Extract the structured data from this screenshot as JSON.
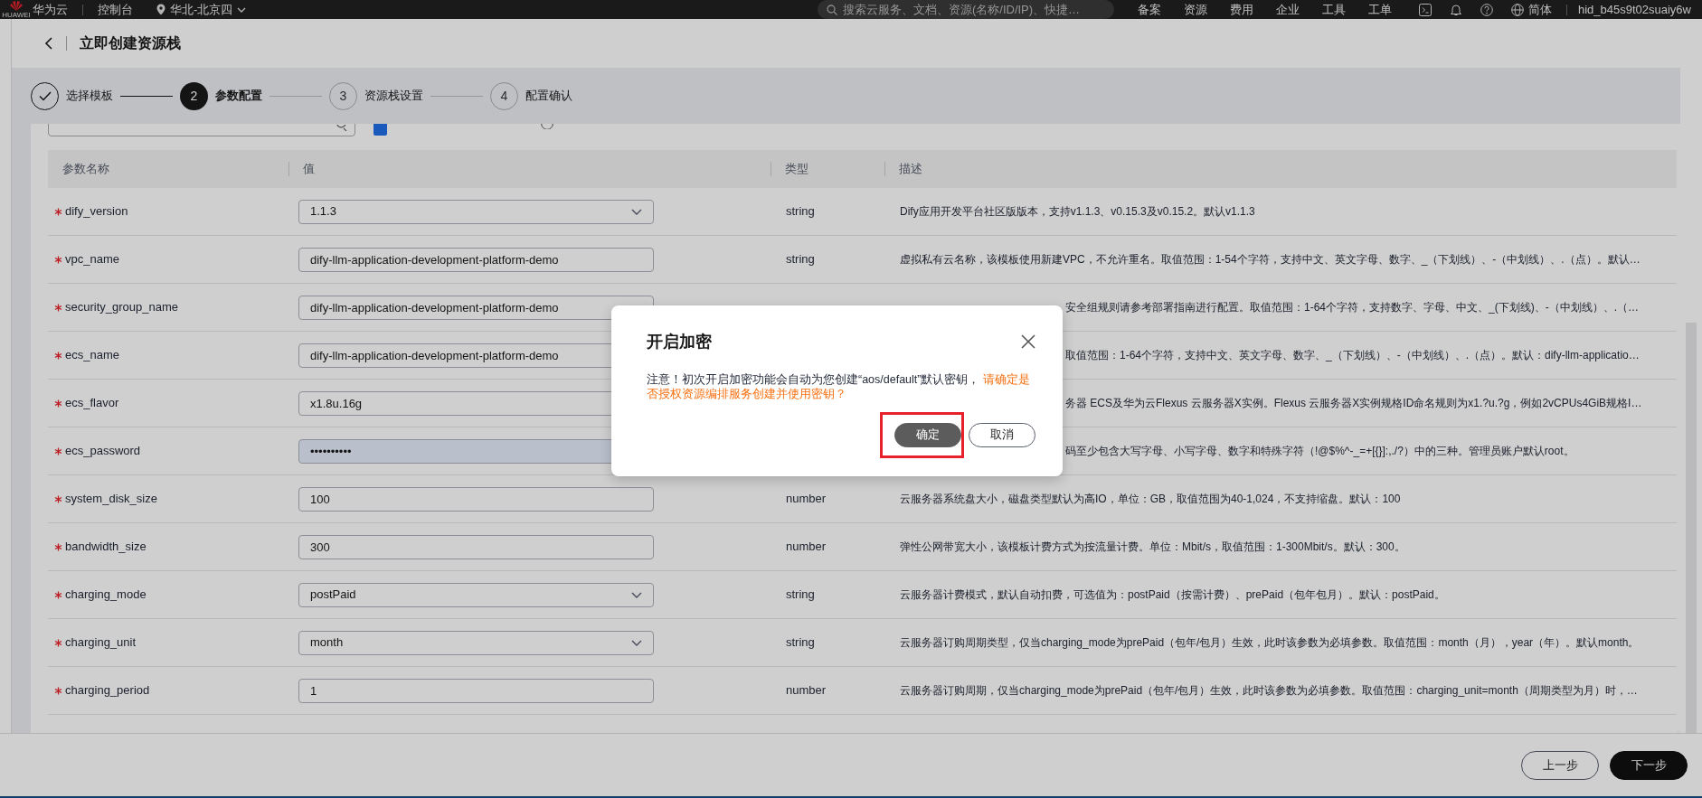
{
  "topbar": {
    "logo_text": "HUAWEI",
    "brand": "华为云",
    "console": "控制台",
    "region": "华北-北京四",
    "search": {
      "placeholder": "搜索云服务、文档、资源(名称/ID/IP)、快捷…"
    },
    "links": [
      "备案",
      "资源",
      "费用",
      "企业",
      "工具",
      "工单"
    ],
    "language": "简体",
    "user": "hid_b45s9t02suaiy6w"
  },
  "page": {
    "title": "立即创建资源栈"
  },
  "steps": [
    {
      "label": "选择模板",
      "completed": true,
      "selected": false
    },
    {
      "number": "2",
      "label": "参数配置",
      "completed": false,
      "selected": true
    },
    {
      "number": "3",
      "label": "资源栈设置",
      "completed": false,
      "selected": false
    },
    {
      "number": "4",
      "label": "配置确认",
      "completed": false,
      "selected": false
    }
  ],
  "filter": {
    "checked": true
  },
  "table": {
    "columns": [
      "参数名称",
      "值",
      "类型",
      "描述"
    ],
    "rows": [
      {
        "name": "dify_version",
        "required": true,
        "kind": "select",
        "value": "1.1.3",
        "type": "string",
        "description": "Dify应用开发平台社区版版本，支持v1.1.3、v0.15.3及v0.15.2。默认v1.1.3"
      },
      {
        "name": "vpc_name",
        "required": true,
        "kind": "text",
        "value": "dify-llm-application-development-platform-demo",
        "type": "string",
        "description": "虚拟私有云名称，该模板使用新建VPC，不允许重名。取值范围：1-54个字符，支持中文、英文字母、数字、_（下划线）、-（中划线）、.（点）。默认…"
      },
      {
        "name": "security_group_name",
        "required": true,
        "kind": "text",
        "value": "dify-llm-application-development-platform-demo",
        "description": "安全组规则请参考部署指南进行配置。取值范围：1-64个字符，支持数字、字母、中文、_(下划线)、-（中划线）、.（…"
      },
      {
        "name": "ecs_name",
        "required": true,
        "kind": "text",
        "value": "dify-llm-application-development-platform-demo",
        "description": "取值范围：1-64个字符，支持中文、英文字母、数字、_（下划线）、-（中划线）、.（点）。默认：dify-llm-applicatio…"
      },
      {
        "name": "ecs_flavor",
        "required": true,
        "kind": "text",
        "value": "x1.8u.16g",
        "description": "务器 ECS及华为云Flexus 云服务器X实例。Flexus 云服务器X实例规格ID命名规则为x1.?u.?g，例如2vCPUs4GiB规格I…"
      },
      {
        "name": "ecs_password",
        "required": true,
        "kind": "password",
        "value": "••••••••••",
        "description": "码至少包含大写字母、小写字母、数字和特殊字符（!@$%^-_=+[{}]:,./?）中的三种。管理员账户默认root。"
      },
      {
        "name": "system_disk_size",
        "required": true,
        "kind": "text",
        "value": "100",
        "type": "number",
        "description": "云服务器系统盘大小，磁盘类型默认为高IO，单位：GB，取值范围为40-1,024，不支持缩盘。默认：100"
      },
      {
        "name": "bandwidth_size",
        "required": true,
        "kind": "text",
        "value": "300",
        "type": "number",
        "description": "弹性公网带宽大小，该模板计费方式为按流量计费。单位：Mbit/s，取值范围：1-300Mbit/s。默认：300。"
      },
      {
        "name": "charging_mode",
        "required": true,
        "kind": "select",
        "value": "postPaid",
        "type": "string",
        "description": "云服务器计费模式，默认自动扣费，可选值为：postPaid（按需计费）、prePaid（包年包月）。默认：postPaid。"
      },
      {
        "name": "charging_unit",
        "required": true,
        "kind": "select",
        "value": "month",
        "type": "string",
        "description": "云服务器订购周期类型，仅当charging_mode为prePaid（包年/包月）生效，此时该参数为必填参数。取值范围：month（月），year（年）。默认month。"
      },
      {
        "name": "charging_period",
        "required": true,
        "kind": "text",
        "value": "1",
        "type": "number",
        "description": "云服务器订购周期，仅当charging_mode为prePaid（包年/包月）生效，此时该参数为必填参数。取值范围：charging_unit=month（周期类型为月）时，…"
      }
    ]
  },
  "dialog": {
    "title": "开启加密",
    "notice": "注意！初次开启加密功能会自动为您创建“aos/default”默认密钥，",
    "question": "请确定是否授权资源编排服务创建并使用密钥？",
    "buttons": [
      {
        "label": "确定",
        "kind": "primary",
        "highlighted": true
      },
      {
        "label": "取消",
        "kind": "secondary",
        "highlighted": false
      }
    ]
  },
  "footer": {
    "buttons": [
      {
        "label": "上一步",
        "kind": "secondary"
      },
      {
        "label": "下一步",
        "kind": "primary"
      }
    ]
  }
}
